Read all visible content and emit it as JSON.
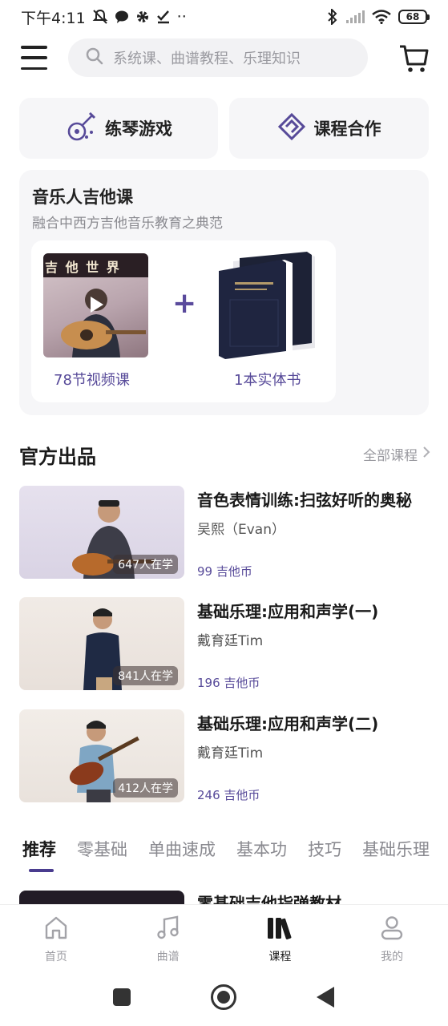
{
  "status_bar": {
    "time": "下午4:11",
    "dots": "··",
    "battery": "68"
  },
  "header": {
    "search_placeholder": "系统课、曲谱教程、乐理知识"
  },
  "quick_actions": [
    {
      "label": "练琴游戏",
      "icon": "guitar-icon"
    },
    {
      "label": "课程合作",
      "icon": "partnership-icon"
    }
  ],
  "promo": {
    "title": "音乐人吉他课",
    "subtitle": "融合中西方吉他音乐教育之典范",
    "video_caption": "78节视频课",
    "book_caption": "1本实体书",
    "plus": "+",
    "thumb_logo_text": "吉 他 世 界"
  },
  "official": {
    "title": "官方出品",
    "more": "全部课程"
  },
  "courses": [
    {
      "title": "音色表情训练:扫弦好听的奥秘",
      "teacher": "吴熙（Evan）",
      "price": "99 吉他币",
      "learners": "647人在学"
    },
    {
      "title": "基础乐理:应用和声学(一)",
      "teacher": "戴育廷Tim",
      "price": "196 吉他币",
      "learners": "841人在学"
    },
    {
      "title": "基础乐理:应用和声学(二)",
      "teacher": "戴育廷Tim",
      "price": "246 吉他币",
      "learners": "412人在学"
    }
  ],
  "tabs": [
    "推荐",
    "零基础",
    "单曲速成",
    "基本功",
    "技巧",
    "基础乐理"
  ],
  "peek": {
    "title": "零基础吉他指弹教材"
  },
  "bottom_nav": [
    {
      "label": "首页",
      "icon": "home-icon"
    },
    {
      "label": "曲谱",
      "icon": "music-note-icon"
    },
    {
      "label": "课程",
      "icon": "books-icon"
    },
    {
      "label": "我的",
      "icon": "profile-icon"
    }
  ],
  "colors": {
    "accent": "#574a99",
    "tab_indicator": "#4a3c8f"
  }
}
